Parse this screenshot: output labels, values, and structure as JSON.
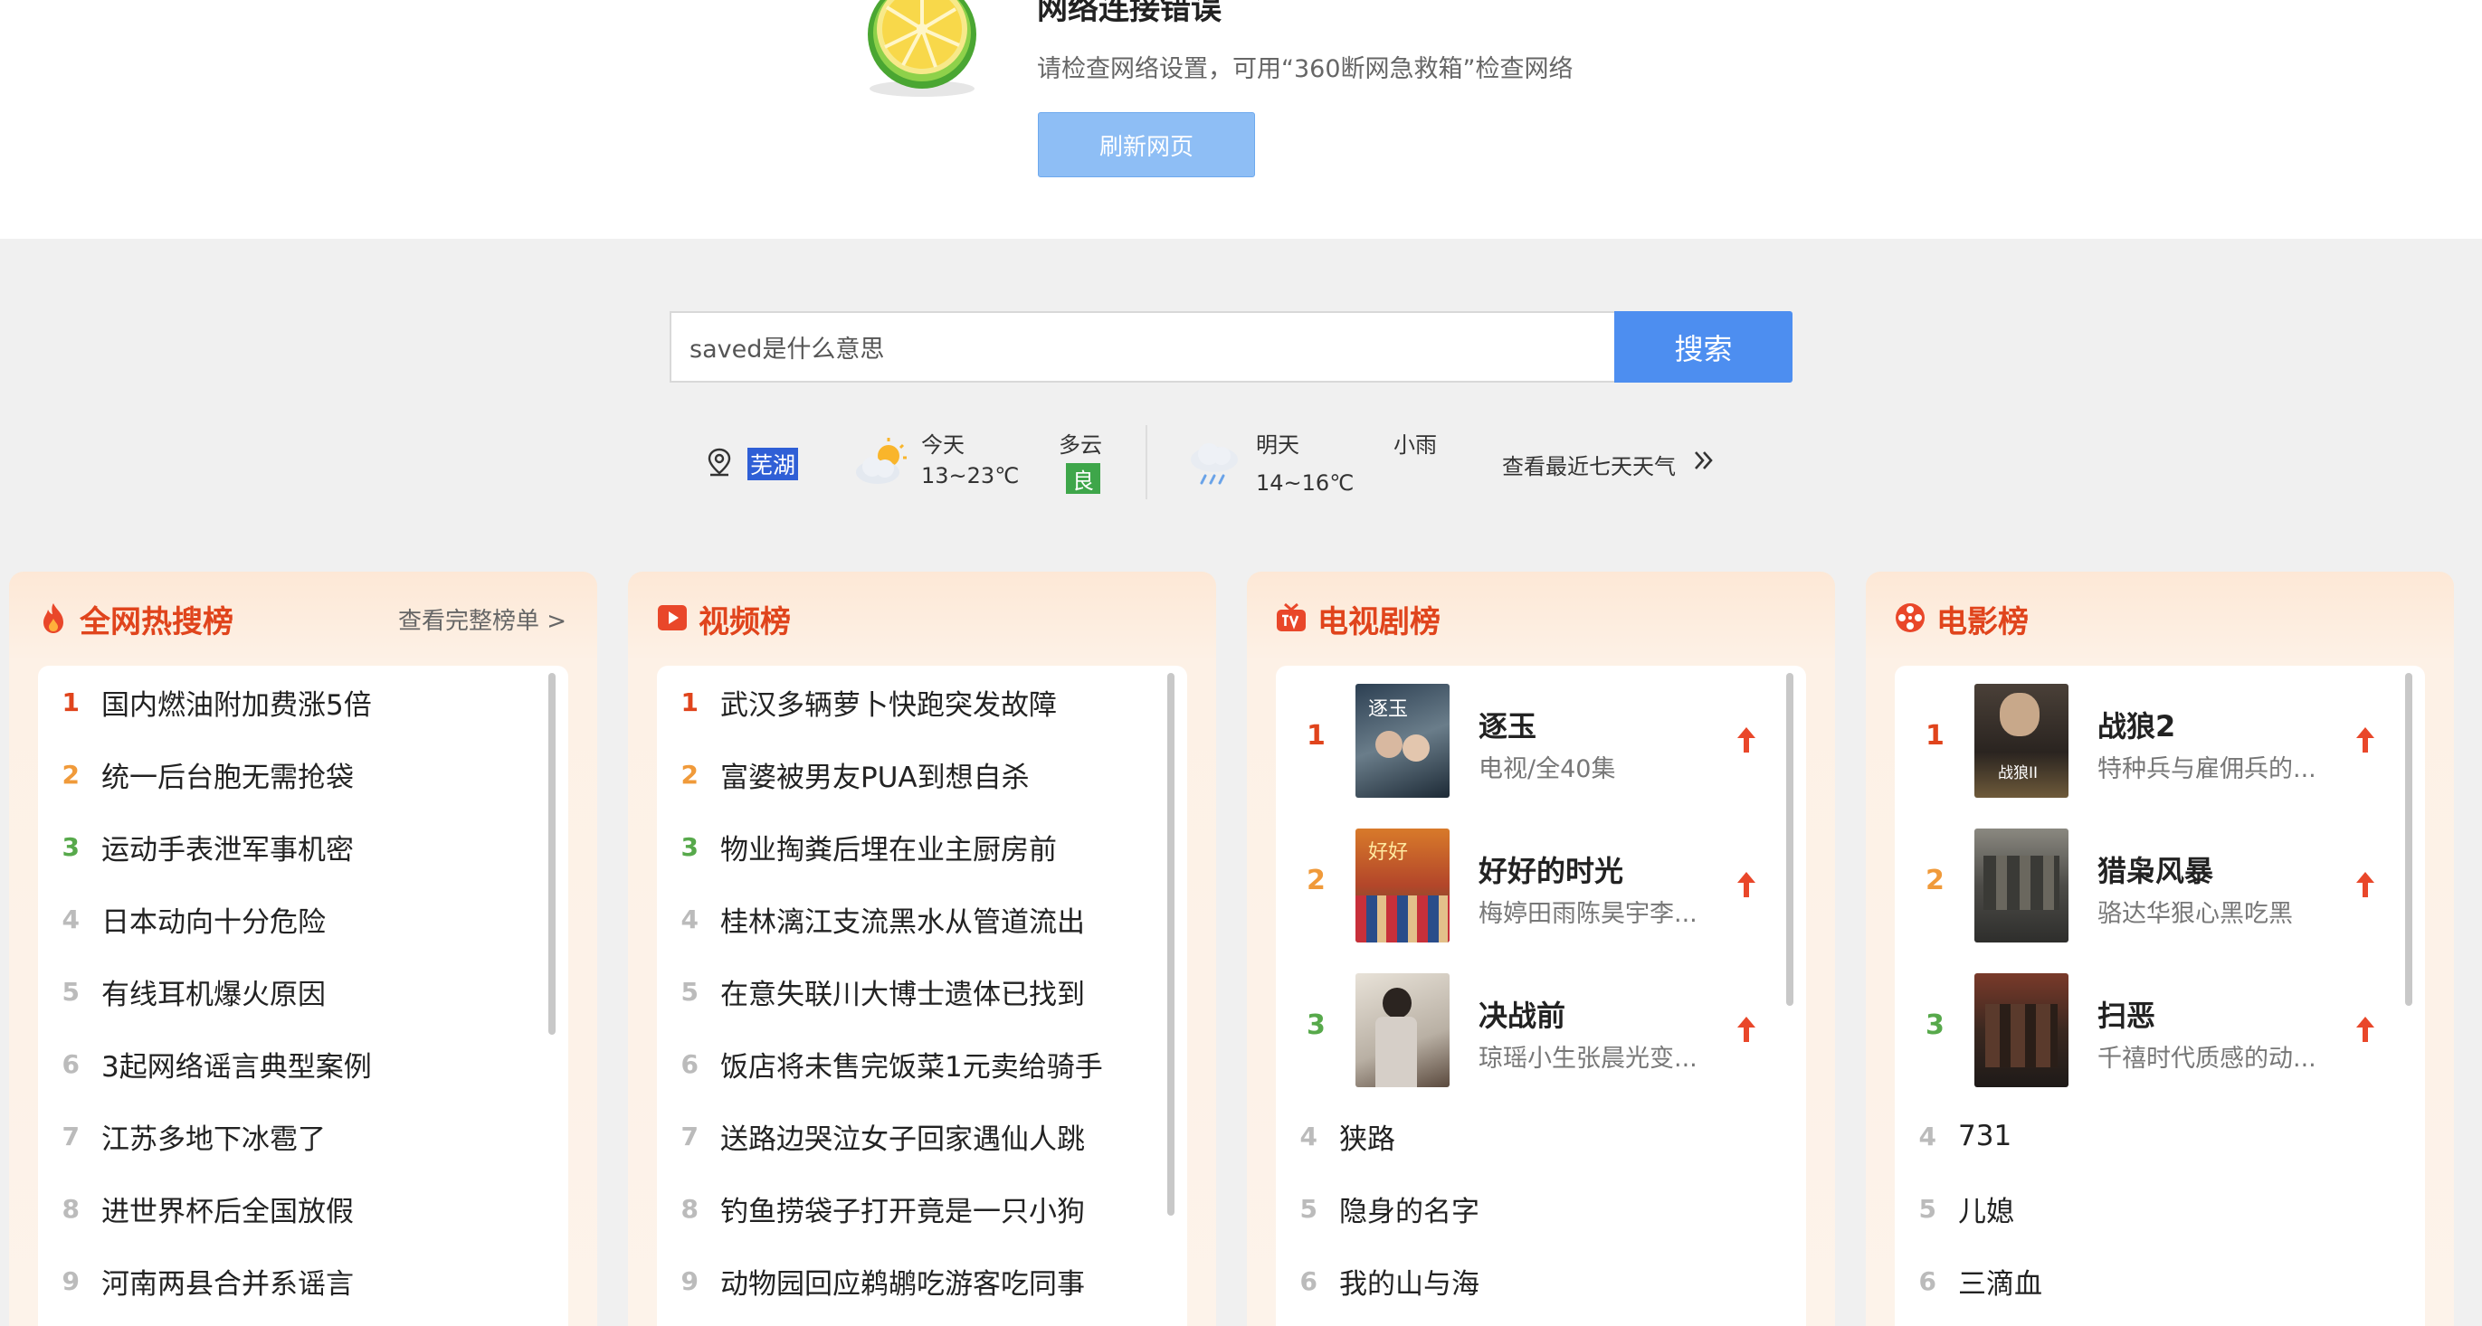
{
  "error": {
    "title": "网络连接错误",
    "description": "请检查网络设置，可用“360断网急救箱”检查网络",
    "refresh_label": "刷新网页"
  },
  "search": {
    "value": "saved是什么意思",
    "button_label": "搜索"
  },
  "weather": {
    "city": "芜湖",
    "today_label": "今天",
    "today_temp": "13~23℃",
    "today_condition": "多云",
    "aqi": "良",
    "tomorrow_label": "明天",
    "tomorrow_temp": "14~16℃",
    "tomorrow_condition": "小雨",
    "week_link": "查看最近七天天气",
    "colors": {
      "aqi_good": "#3ea64a",
      "city_highlight": "#2f5fd6"
    }
  },
  "hot_search": {
    "title": "全网热搜榜",
    "more_label": "查看完整榜单 >",
    "items": [
      {
        "rank": "1",
        "text": "国内燃油附加费涨5倍"
      },
      {
        "rank": "2",
        "text": "统一后台胞无需抢袋"
      },
      {
        "rank": "3",
        "text": "运动手表泄军事机密"
      },
      {
        "rank": "4",
        "text": "日本动向十分危险"
      },
      {
        "rank": "5",
        "text": "有线耳机爆火原因"
      },
      {
        "rank": "6",
        "text": "3起网络谣言典型案例"
      },
      {
        "rank": "7",
        "text": "江苏多地下冰雹了"
      },
      {
        "rank": "8",
        "text": "进世界杯后全国放假"
      },
      {
        "rank": "9",
        "text": "河南两县合并系谣言"
      }
    ]
  },
  "video": {
    "title": "视频榜",
    "items": [
      {
        "rank": "1",
        "text": "武汉多辆萝卜快跑突发故障"
      },
      {
        "rank": "2",
        "text": "富婆被男友PUA到想自杀"
      },
      {
        "rank": "3",
        "text": "物业掏粪后埋在业主厨房前"
      },
      {
        "rank": "4",
        "text": "桂林漓江支流黑水从管道流出"
      },
      {
        "rank": "5",
        "text": "在意失联川大博士遗体已找到"
      },
      {
        "rank": "6",
        "text": "饭店将未售完饭菜1元卖给骑手"
      },
      {
        "rank": "7",
        "text": "送路边哭泣女子回家遇仙人跳"
      },
      {
        "rank": "8",
        "text": "钓鱼捞袋子打开竟是一只小狗"
      },
      {
        "rank": "9",
        "text": "动物园回应鹈鹕吃游客吃同事"
      }
    ]
  },
  "tv": {
    "title": "电视剧榜",
    "top": [
      {
        "rank": "1",
        "title": "逐玉",
        "sub": "电视/全40集",
        "poster_text": "逐玉"
      },
      {
        "rank": "2",
        "title": "好好的时光",
        "sub": "梅婷田雨陈昊宇李...",
        "poster_text": "好好"
      },
      {
        "rank": "3",
        "title": "决战前",
        "sub": "琼瑶小生张晨光变...",
        "poster_text": ""
      }
    ],
    "items": [
      {
        "rank": "4",
        "text": "狭路"
      },
      {
        "rank": "5",
        "text": "隐身的名字"
      },
      {
        "rank": "6",
        "text": "我的山与海"
      }
    ]
  },
  "movie": {
    "title": "电影榜",
    "top": [
      {
        "rank": "1",
        "title": "战狼2",
        "sub": "特种兵与雇佣兵的...",
        "poster_text": "战狼II"
      },
      {
        "rank": "2",
        "title": "猎枭风暴",
        "sub": "骆达华狠心黑吃黑",
        "poster_text": ""
      },
      {
        "rank": "3",
        "title": "扫恶",
        "sub": "千禧时代质感的动...",
        "poster_text": ""
      }
    ],
    "items": [
      {
        "rank": "4",
        "text": "731"
      },
      {
        "rank": "5",
        "text": "儿媳"
      },
      {
        "rank": "6",
        "text": "三滴血"
      }
    ]
  },
  "colors": {
    "accent": "#e0441c",
    "rank1": "#e0441c",
    "rank2": "#f09a3a",
    "rank3": "#57a94b",
    "search_button": "#4d8ef0",
    "refresh_button": "#8ebef5"
  }
}
